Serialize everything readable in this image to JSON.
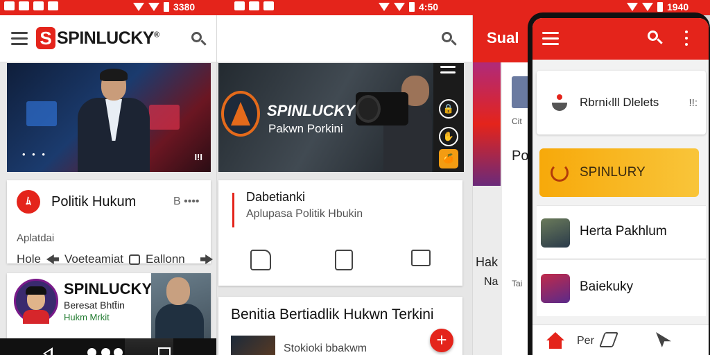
{
  "status": {
    "time1": "3380",
    "time2": "4:50",
    "time3": "1940"
  },
  "panel1": {
    "brand_letter": "S",
    "brand_name": "SPINLUCKY",
    "brand_mark": "®",
    "hero_dots": "• • •",
    "hero_tag": "I!I",
    "card1": {
      "avatar": "ﾑ",
      "title": "Politik Hukum",
      "more": "B ••••",
      "subtitle": "Aplatdai",
      "action1": "Hole",
      "action2": "Voeteamiat",
      "action3": "Eallonn"
    },
    "card2": {
      "title": "SPINLUCKY",
      "sub1": "Beresat Bhtt̄in",
      "sub2": "Hukm Mrkit"
    }
  },
  "panel2": {
    "hero_title": "SPINLUCKY",
    "hero_subtitle": "Pakwn Porkini",
    "side_icons": [
      "🔒",
      "✋",
      "🍊"
    ],
    "card3": {
      "title": "Dabetianki",
      "subtitle": "Aplupasa Politik Hbukin"
    },
    "card4": {
      "title": "Benitia Bertiadlik Hukwn Terkini",
      "subtitle": "Stokioki bbakwm"
    },
    "fab": "+"
  },
  "panel3": {
    "title": "Sual",
    "lines": [
      "Cit",
      "Po",
      "Hak",
      "Na",
      "Tai"
    ]
  },
  "phone": {
    "row1_text": "Rbrni‹lll Dlelets",
    "row1_icon": "!!:",
    "yellow_label": "SPINLURY",
    "items": [
      {
        "label": "Herta Pakhlum"
      },
      {
        "label": "Baiekuky"
      }
    ],
    "bottom_label": "Per"
  },
  "colors": {
    "brand_red": "#e4241b",
    "accent_yellow": "#f7a90a"
  }
}
